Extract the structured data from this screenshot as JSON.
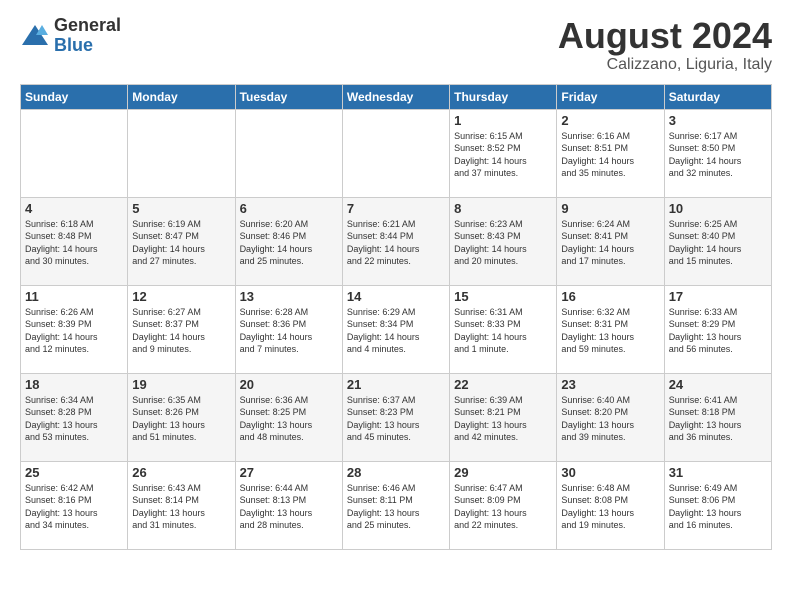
{
  "logo": {
    "general": "General",
    "blue": "Blue"
  },
  "title": {
    "month_year": "August 2024",
    "location": "Calizzano, Liguria, Italy"
  },
  "weekdays": [
    "Sunday",
    "Monday",
    "Tuesday",
    "Wednesday",
    "Thursday",
    "Friday",
    "Saturday"
  ],
  "weeks": [
    [
      {
        "day": "",
        "info": ""
      },
      {
        "day": "",
        "info": ""
      },
      {
        "day": "",
        "info": ""
      },
      {
        "day": "",
        "info": ""
      },
      {
        "day": "1",
        "info": "Sunrise: 6:15 AM\nSunset: 8:52 PM\nDaylight: 14 hours\nand 37 minutes."
      },
      {
        "day": "2",
        "info": "Sunrise: 6:16 AM\nSunset: 8:51 PM\nDaylight: 14 hours\nand 35 minutes."
      },
      {
        "day": "3",
        "info": "Sunrise: 6:17 AM\nSunset: 8:50 PM\nDaylight: 14 hours\nand 32 minutes."
      }
    ],
    [
      {
        "day": "4",
        "info": "Sunrise: 6:18 AM\nSunset: 8:48 PM\nDaylight: 14 hours\nand 30 minutes."
      },
      {
        "day": "5",
        "info": "Sunrise: 6:19 AM\nSunset: 8:47 PM\nDaylight: 14 hours\nand 27 minutes."
      },
      {
        "day": "6",
        "info": "Sunrise: 6:20 AM\nSunset: 8:46 PM\nDaylight: 14 hours\nand 25 minutes."
      },
      {
        "day": "7",
        "info": "Sunrise: 6:21 AM\nSunset: 8:44 PM\nDaylight: 14 hours\nand 22 minutes."
      },
      {
        "day": "8",
        "info": "Sunrise: 6:23 AM\nSunset: 8:43 PM\nDaylight: 14 hours\nand 20 minutes."
      },
      {
        "day": "9",
        "info": "Sunrise: 6:24 AM\nSunset: 8:41 PM\nDaylight: 14 hours\nand 17 minutes."
      },
      {
        "day": "10",
        "info": "Sunrise: 6:25 AM\nSunset: 8:40 PM\nDaylight: 14 hours\nand 15 minutes."
      }
    ],
    [
      {
        "day": "11",
        "info": "Sunrise: 6:26 AM\nSunset: 8:39 PM\nDaylight: 14 hours\nand 12 minutes."
      },
      {
        "day": "12",
        "info": "Sunrise: 6:27 AM\nSunset: 8:37 PM\nDaylight: 14 hours\nand 9 minutes."
      },
      {
        "day": "13",
        "info": "Sunrise: 6:28 AM\nSunset: 8:36 PM\nDaylight: 14 hours\nand 7 minutes."
      },
      {
        "day": "14",
        "info": "Sunrise: 6:29 AM\nSunset: 8:34 PM\nDaylight: 14 hours\nand 4 minutes."
      },
      {
        "day": "15",
        "info": "Sunrise: 6:31 AM\nSunset: 8:33 PM\nDaylight: 14 hours\nand 1 minute."
      },
      {
        "day": "16",
        "info": "Sunrise: 6:32 AM\nSunset: 8:31 PM\nDaylight: 13 hours\nand 59 minutes."
      },
      {
        "day": "17",
        "info": "Sunrise: 6:33 AM\nSunset: 8:29 PM\nDaylight: 13 hours\nand 56 minutes."
      }
    ],
    [
      {
        "day": "18",
        "info": "Sunrise: 6:34 AM\nSunset: 8:28 PM\nDaylight: 13 hours\nand 53 minutes."
      },
      {
        "day": "19",
        "info": "Sunrise: 6:35 AM\nSunset: 8:26 PM\nDaylight: 13 hours\nand 51 minutes."
      },
      {
        "day": "20",
        "info": "Sunrise: 6:36 AM\nSunset: 8:25 PM\nDaylight: 13 hours\nand 48 minutes."
      },
      {
        "day": "21",
        "info": "Sunrise: 6:37 AM\nSunset: 8:23 PM\nDaylight: 13 hours\nand 45 minutes."
      },
      {
        "day": "22",
        "info": "Sunrise: 6:39 AM\nSunset: 8:21 PM\nDaylight: 13 hours\nand 42 minutes."
      },
      {
        "day": "23",
        "info": "Sunrise: 6:40 AM\nSunset: 8:20 PM\nDaylight: 13 hours\nand 39 minutes."
      },
      {
        "day": "24",
        "info": "Sunrise: 6:41 AM\nSunset: 8:18 PM\nDaylight: 13 hours\nand 36 minutes."
      }
    ],
    [
      {
        "day": "25",
        "info": "Sunrise: 6:42 AM\nSunset: 8:16 PM\nDaylight: 13 hours\nand 34 minutes."
      },
      {
        "day": "26",
        "info": "Sunrise: 6:43 AM\nSunset: 8:14 PM\nDaylight: 13 hours\nand 31 minutes."
      },
      {
        "day": "27",
        "info": "Sunrise: 6:44 AM\nSunset: 8:13 PM\nDaylight: 13 hours\nand 28 minutes."
      },
      {
        "day": "28",
        "info": "Sunrise: 6:46 AM\nSunset: 8:11 PM\nDaylight: 13 hours\nand 25 minutes."
      },
      {
        "day": "29",
        "info": "Sunrise: 6:47 AM\nSunset: 8:09 PM\nDaylight: 13 hours\nand 22 minutes."
      },
      {
        "day": "30",
        "info": "Sunrise: 6:48 AM\nSunset: 8:08 PM\nDaylight: 13 hours\nand 19 minutes."
      },
      {
        "day": "31",
        "info": "Sunrise: 6:49 AM\nSunset: 8:06 PM\nDaylight: 13 hours\nand 16 minutes."
      }
    ]
  ]
}
